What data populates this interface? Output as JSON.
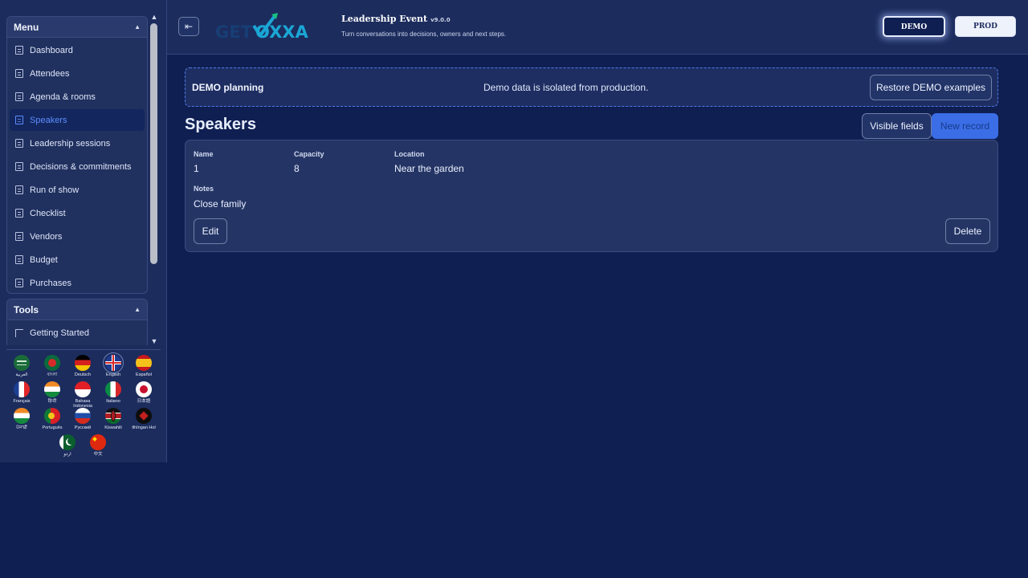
{
  "sidebar": {
    "menu_title": "Menu",
    "items": [
      {
        "label": "Dashboard"
      },
      {
        "label": "Attendees"
      },
      {
        "label": "Agenda & rooms"
      },
      {
        "label": "Speakers",
        "active": true
      },
      {
        "label": "Leadership sessions"
      },
      {
        "label": "Decisions & commitments"
      },
      {
        "label": "Run of show"
      },
      {
        "label": "Checklist"
      },
      {
        "label": "Vendors"
      },
      {
        "label": "Budget"
      },
      {
        "label": "Purchases"
      }
    ],
    "tools_title": "Tools",
    "tools_items": [
      {
        "label": "Getting Started"
      }
    ]
  },
  "languages": [
    {
      "label": "العربية",
      "flag": "saudi-arabia"
    },
    {
      "label": "বাংলা",
      "flag": "bangladesh"
    },
    {
      "label": "Deutsch",
      "flag": "germany"
    },
    {
      "label": "English",
      "flag": "united-kingdom",
      "active": true
    },
    {
      "label": "Español",
      "flag": "spain"
    },
    {
      "label": "Français",
      "flag": "france"
    },
    {
      "label": "हिन्दी",
      "flag": "india"
    },
    {
      "label": "Bahasa Indonesia",
      "flag": "indonesia"
    },
    {
      "label": "Italiano",
      "flag": "italy"
    },
    {
      "label": "日本語",
      "flag": "japan"
    },
    {
      "label": "ਪੰਜਾਬੀ",
      "flag": "india"
    },
    {
      "label": "Português",
      "flag": "portugal"
    },
    {
      "label": "Русский",
      "flag": "russia"
    },
    {
      "label": "Kiswahili",
      "flag": "kenya"
    },
    {
      "label": "tlhIngan Hol",
      "flag": "klingon"
    },
    {
      "label": "اردو",
      "flag": "pakistan"
    },
    {
      "label": "中文",
      "flag": "china"
    }
  ],
  "header": {
    "logo_part1": "GET",
    "logo_part2": "OXXA",
    "title": "Leadership Event",
    "version": "v9.0.0",
    "subtitle": "Turn conversations into decisions, owners and next steps.",
    "env_demo": "DEMO",
    "env_prod": "PROD"
  },
  "banner": {
    "title": "DEMO planning",
    "message": "Demo data is isolated from production.",
    "restore_label": "Restore DEMO examples"
  },
  "page": {
    "title": "Speakers",
    "visible_fields_label": "Visible fields",
    "new_record_label": "New record"
  },
  "record": {
    "name_label": "Name",
    "name_value": "1",
    "capacity_label": "Capacity",
    "capacity_value": "8",
    "location_label": "Location",
    "location_value": "Near the garden",
    "notes_label": "Notes",
    "notes_value": "Close family",
    "edit_label": "Edit",
    "delete_label": "Delete"
  },
  "colors": {
    "background": "#0f1f52",
    "panel": "#1c2c5d",
    "accent": "#3b6ee6",
    "active_text": "#5e8cff"
  }
}
